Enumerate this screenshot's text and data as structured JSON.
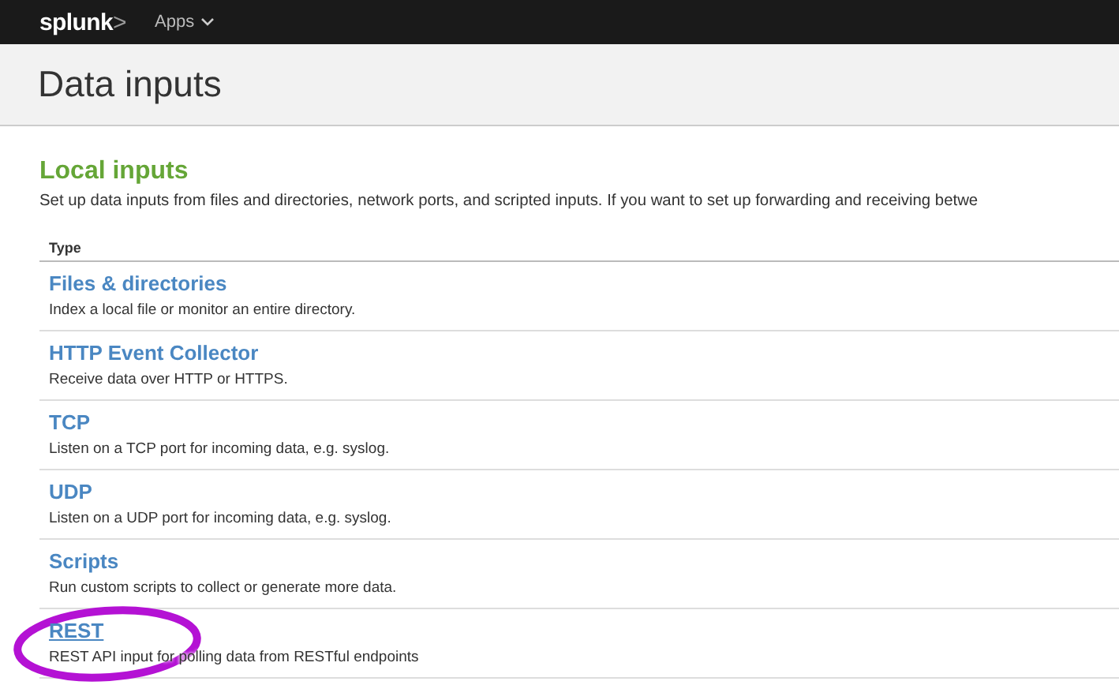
{
  "navbar": {
    "logo": {
      "text": "splunk",
      "mark": ">"
    },
    "menu": "Apps"
  },
  "page_title": "Data inputs",
  "section": {
    "title": "Local inputs",
    "description": "Set up data inputs from files and directories, network ports, and scripted inputs. If you want to set up forwarding and receiving betwe"
  },
  "table": {
    "columns": [
      "Type"
    ],
    "rows": [
      {
        "name": "Files & directories",
        "description": "Index a local file or monitor an entire directory.",
        "hovered": false,
        "circled": false
      },
      {
        "name": "HTTP Event Collector",
        "description": "Receive data over HTTP or HTTPS.",
        "hovered": false,
        "circled": false
      },
      {
        "name": "TCP",
        "description": "Listen on a TCP port for incoming data, e.g. syslog.",
        "hovered": false,
        "circled": false
      },
      {
        "name": "UDP",
        "description": "Listen on a UDP port for incoming data, e.g. syslog.",
        "hovered": false,
        "circled": false
      },
      {
        "name": "Scripts",
        "description": "Run custom scripts to collect or generate more data.",
        "hovered": false,
        "circled": false
      },
      {
        "name": "REST",
        "description": "REST API input for polling data from RESTful endpoints",
        "hovered": true,
        "circled": true
      }
    ]
  }
}
